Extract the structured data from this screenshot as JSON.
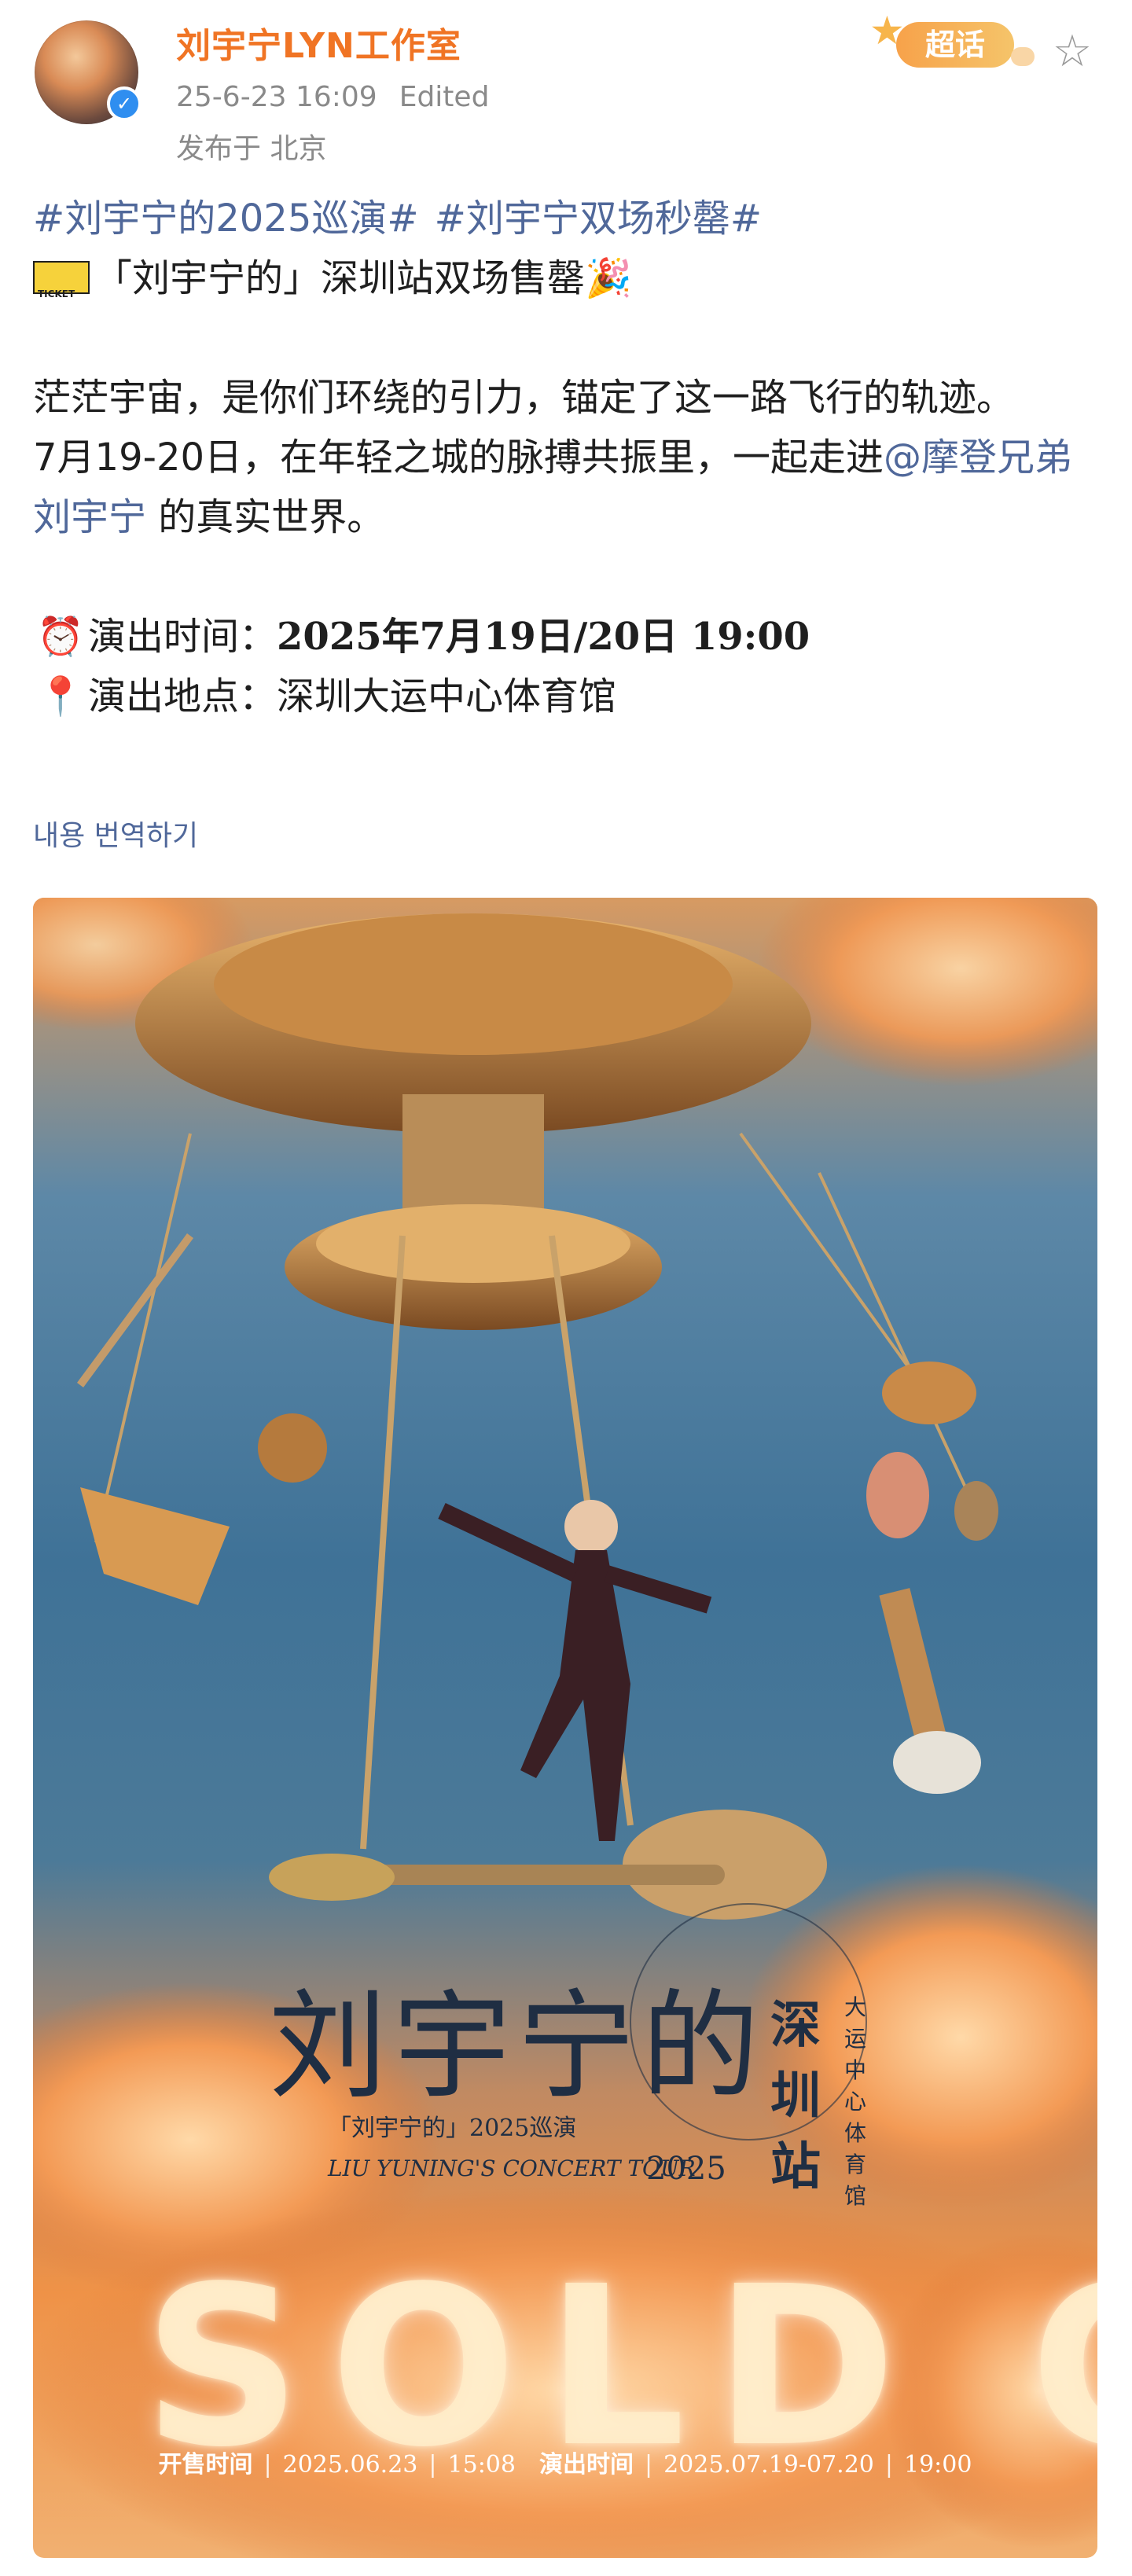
{
  "author": {
    "name": "刘宇宁LYN工作室",
    "timestamp": "25-6-23 16:09",
    "edited": "Edited",
    "location": "发布于 北京",
    "verified_icon": "verified-check-icon",
    "supertopic_label": "超话",
    "favorite_icon": "star-outline-icon"
  },
  "post": {
    "hashtags": [
      "#刘宇宁的2025巡演#",
      "#刘宇宁双场秒罄#"
    ],
    "headline": "「刘宇宁的」深圳站双场售罄",
    "paragraph1": "茫茫宇宙，是你们环绕的引力，锚定了这一路飞行的轨迹。",
    "paragraph2_prefix": "7月19-20日，在年轻之城的脉搏共振里，一起走进",
    "mention": "@摩登兄弟刘宇宁",
    "paragraph2_suffix": " 的真实世界。",
    "time_label": "演出时间：",
    "time_value": "2025年7月19日/20日 19:00",
    "place_label": "演出地点：",
    "place_value": "深圳大运中心体育馆",
    "translate_link": "내용 번역하기"
  },
  "poster": {
    "title": "刘宇宁的",
    "subtitle_cn": "「刘宇宁的」2025巡演",
    "subtitle_en": "LIU YUNING'S CONCERT TOUR",
    "year": "2025",
    "station": "深圳站",
    "venue": "大运中心体育馆",
    "sold_out": "SOLD OUT",
    "presale_label": "开售时间",
    "presale_date": "2025.06.23",
    "presale_time": "15:08",
    "show_label": "演出时间",
    "show_dates": "2025.07.19-07.20",
    "show_time": "19:00"
  },
  "colors": {
    "author_name": "#f07424",
    "link": "#50689a",
    "meta": "#8a8a8a"
  }
}
